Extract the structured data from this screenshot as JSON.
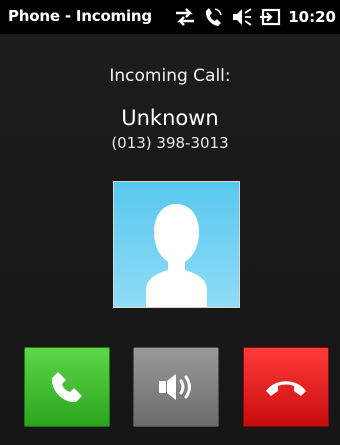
{
  "status_bar": {
    "title": "Phone - Incoming",
    "time": "10:20",
    "icons": [
      "data-sync-icon",
      "phone-call-icon",
      "speaker-icon",
      "battery-icon"
    ]
  },
  "call": {
    "label": "Incoming Call:",
    "caller_name": "Unknown",
    "caller_number": "(013) 398-3013"
  },
  "actions": {
    "answer_icon": "phone-handset-icon",
    "speaker_icon": "speaker-volume-icon",
    "decline_icon": "hang-up-icon"
  },
  "colors": {
    "answer": "#2aa51c",
    "speaker": "#6b6b6b",
    "decline": "#c80d0d",
    "avatar_bg": "#58c8ee"
  }
}
